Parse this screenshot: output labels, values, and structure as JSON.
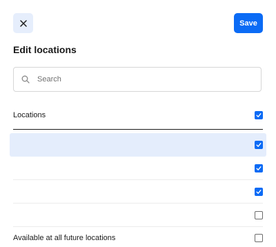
{
  "dialog": {
    "title": "Edit locations",
    "save_label": "Save",
    "close_icon": "close-icon"
  },
  "search": {
    "placeholder": "Search",
    "value": "",
    "icon": "search-icon"
  },
  "list": {
    "header_label": "Locations",
    "header_checked": true,
    "rows": [
      {
        "label": "",
        "checked": true,
        "highlighted": true
      },
      {
        "label": "",
        "checked": true,
        "highlighted": false
      },
      {
        "label": "",
        "checked": true,
        "highlighted": false
      },
      {
        "label": "",
        "checked": false,
        "highlighted": false
      }
    ]
  },
  "future": {
    "label": "Available at all future locations",
    "checked": false
  },
  "colors": {
    "accent": "#0b6bf5",
    "highlight": "#e4edfc",
    "close_bg": "#e6eefc"
  }
}
